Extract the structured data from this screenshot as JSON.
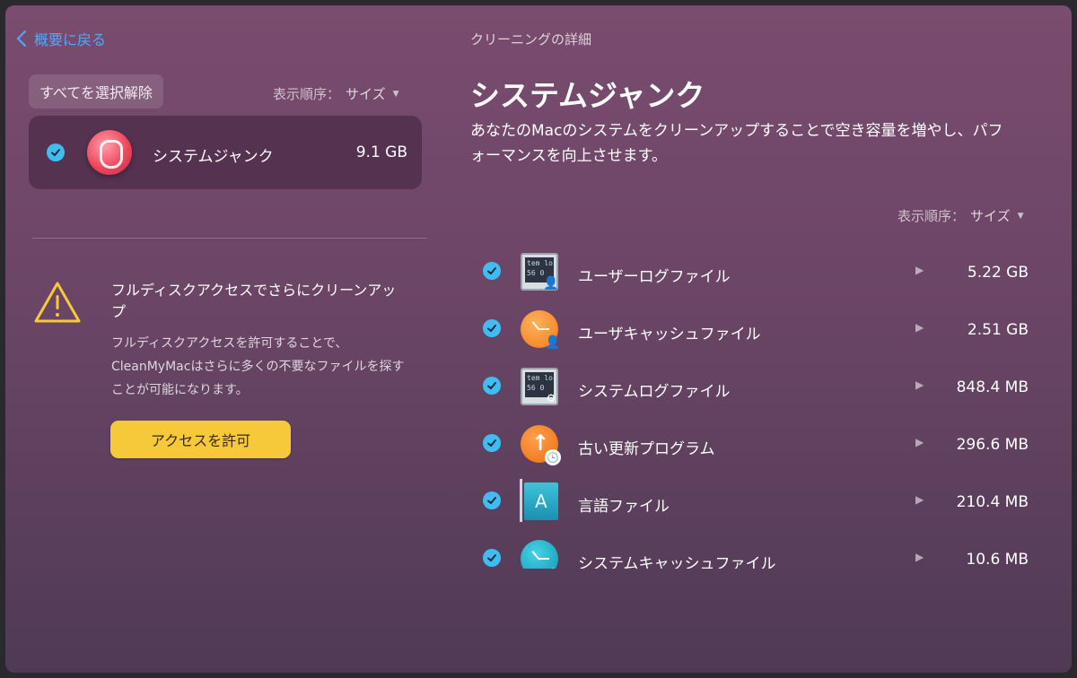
{
  "nav": {
    "back_label": "概要に戻る"
  },
  "left": {
    "deselect_all_label": "すべてを選択解除",
    "sort": {
      "label": "表示順序：",
      "value": "サイズ"
    },
    "junk_card": {
      "name": "システムジャンク",
      "size": "9.1 GB"
    },
    "warning": {
      "title": "フルディスクアクセスでさらにクリーンアップ",
      "body": "フルディスクアクセスを許可することで、CleanMyMacはさらに多くの不要なファイルを探すことが可能になります。",
      "button_label": "アクセスを許可"
    }
  },
  "right": {
    "breadcrumb": "クリーニングの詳細",
    "title": "システムジャンク",
    "description": "あなたのMacのシステムをクリーンアップすることで空き容量を増やし、パフォーマンスを向上させます。",
    "sort": {
      "label": "表示順序：",
      "value": "サイズ"
    },
    "items": [
      {
        "name": "ユーザーログファイル",
        "size": "5.22 GB",
        "icon": "user-log-icon"
      },
      {
        "name": "ユーザキャッシュファイル",
        "size": "2.51 GB",
        "icon": "user-cache-icon"
      },
      {
        "name": "システムログファイル",
        "size": "848.4 MB",
        "icon": "system-log-icon"
      },
      {
        "name": "古い更新プログラム",
        "size": "296.6 MB",
        "icon": "old-updates-icon"
      },
      {
        "name": "言語ファイル",
        "size": "210.4 MB",
        "icon": "language-files-icon"
      },
      {
        "name": "システムキャッシュファイル",
        "size": "10.6 MB",
        "icon": "system-cache-icon"
      }
    ]
  },
  "colors": {
    "accent": "#3fbdf3",
    "link": "#4fa8ff",
    "button": "#f5c93a"
  }
}
